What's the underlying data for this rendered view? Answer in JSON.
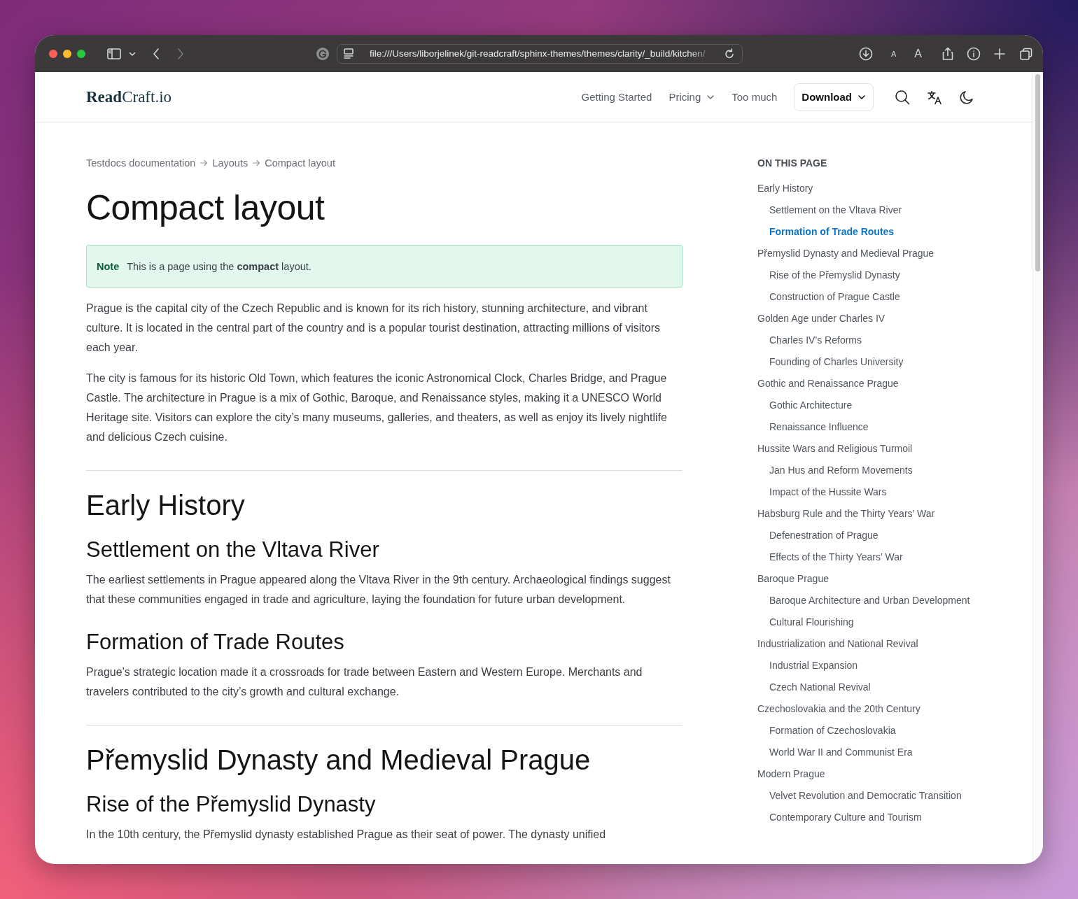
{
  "browser": {
    "url": "file:///Users/liborjelinek/git-readcraft/sphinx-themes/themes/clarity/_build/kitchen/",
    "text_size_small": "A",
    "text_size_large": "A"
  },
  "header": {
    "logo": "**Read**Craft.io",
    "nav": [
      {
        "label": "Getting Started",
        "kind": "link"
      },
      {
        "label": "Pricing",
        "kind": "dropdown"
      },
      {
        "label": "Too much",
        "kind": "link"
      },
      {
        "label": "Download",
        "kind": "button"
      }
    ]
  },
  "article": {
    "breadcrumbs": [
      "Testdocs documentation",
      "Layouts",
      "Compact layout"
    ],
    "title": "Compact layout",
    "note": {
      "label": "Note",
      "text": "This is a page using the **compact** layout."
    },
    "blocks": [
      {
        "kind": "paragraph",
        "text": "Prague is the capital city of the Czech Republic and is known for its rich history, stunning architecture, and vibrant culture. It is located in the central part of the country and is a popular tourist destination, attracting millions of visitors each year."
      },
      {
        "kind": "paragraph",
        "text": "The city is famous for its historic Old Town, which features the iconic Astronomical Clock, Charles Bridge, and Prague Castle. The architecture in Prague is a mix of Gothic, Baroque, and Renaissance styles, making it a UNESCO World Heritage site. Visitors can explore the city’s many museums, galleries, and theaters, as well as enjoy its lively nightlife and delicious Czech cuisine."
      },
      {
        "kind": "divider"
      },
      {
        "kind": "heading1",
        "text": "Early History"
      },
      {
        "kind": "heading2",
        "text": "Settlement on the Vltava River"
      },
      {
        "kind": "paragraph",
        "text": "The earliest settlements in Prague appeared along the Vltava River in the 9th century. Archaeological findings suggest that these communities engaged in trade and agriculture, laying the foundation for future urban development."
      },
      {
        "kind": "heading2",
        "text": "Formation of Trade Routes"
      },
      {
        "kind": "paragraph",
        "text": "Prague’s strategic location made it a crossroads for trade between Eastern and Western Europe. Merchants and travelers contributed to the city’s growth and cultural exchange."
      },
      {
        "kind": "divider"
      },
      {
        "kind": "heading1",
        "text": "Přemyslid Dynasty and Medieval Prague"
      },
      {
        "kind": "heading2",
        "text": "Rise of the Přemyslid Dynasty"
      },
      {
        "kind": "paragraph",
        "text": "In the 10th century, the Přemyslid dynasty established Prague as their seat of power. The dynasty unified"
      }
    ]
  },
  "toc": {
    "title": "ON THIS PAGE",
    "items": [
      {
        "label": "Early History",
        "selected": false,
        "children": [
          {
            "label": "Settlement on the Vltava River",
            "selected": false
          },
          {
            "label": "Formation of Trade Routes",
            "selected": true
          }
        ]
      },
      {
        "label": "Přemyslid Dynasty and Medieval Prague",
        "selected": false,
        "children": [
          {
            "label": "Rise of the Přemyslid Dynasty",
            "selected": false
          },
          {
            "label": "Construction of Prague Castle",
            "selected": false
          }
        ]
      },
      {
        "label": "Golden Age under Charles IV",
        "selected": false,
        "children": [
          {
            "label": "Charles IV’s Reforms",
            "selected": false
          },
          {
            "label": "Founding of Charles University",
            "selected": false
          }
        ]
      },
      {
        "label": "Gothic and Renaissance Prague",
        "selected": false,
        "children": [
          {
            "label": "Gothic Architecture",
            "selected": false
          },
          {
            "label": "Renaissance Influence",
            "selected": false
          }
        ]
      },
      {
        "label": "Hussite Wars and Religious Turmoil",
        "selected": false,
        "children": [
          {
            "label": "Jan Hus and Reform Movements",
            "selected": false
          },
          {
            "label": "Impact of the Hussite Wars",
            "selected": false
          }
        ]
      },
      {
        "label": "Habsburg Rule and the Thirty Years’ War",
        "selected": false,
        "children": [
          {
            "label": "Defenestration of Prague",
            "selected": false
          },
          {
            "label": "Effects of the Thirty Years’ War",
            "selected": false
          }
        ]
      },
      {
        "label": "Baroque Prague",
        "selected": false,
        "children": [
          {
            "label": "Baroque Architecture and Urban Development",
            "selected": false
          },
          {
            "label": "Cultural Flourishing",
            "selected": false
          }
        ]
      },
      {
        "label": "Industrialization and National Revival",
        "selected": false,
        "children": [
          {
            "label": "Industrial Expansion",
            "selected": false
          },
          {
            "label": "Czech National Revival",
            "selected": false
          }
        ]
      },
      {
        "label": "Czechoslovakia and the 20th Century",
        "selected": false,
        "children": [
          {
            "label": "Formation of Czechoslovakia",
            "selected": false
          },
          {
            "label": "World War II and Communist Era",
            "selected": false
          }
        ]
      },
      {
        "label": "Modern Prague",
        "selected": false,
        "children": [
          {
            "label": "Velvet Revolution and Democratic Transition",
            "selected": false
          },
          {
            "label": "Contemporary Culture and Tourism",
            "selected": false
          }
        ]
      }
    ]
  }
}
